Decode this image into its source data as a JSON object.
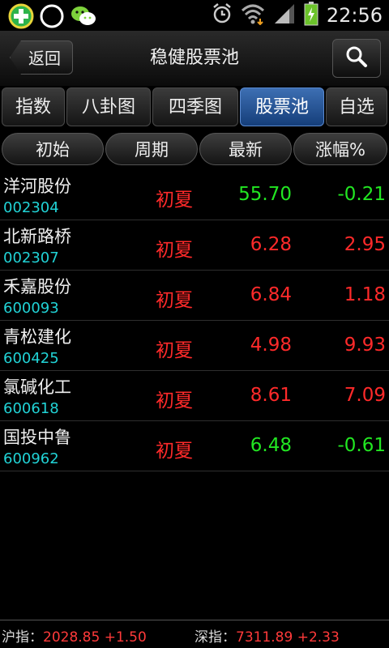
{
  "status_bar": {
    "time": "22:56",
    "left_icons": [
      "360-security-icon",
      "moon-app-icon",
      "wechat-icon"
    ],
    "right_icons": [
      "alarm-icon",
      "wifi-icon",
      "signal-icon",
      "battery-charging-icon"
    ]
  },
  "header": {
    "back_label": "返回",
    "title": "稳健股票池",
    "search_icon": "search-icon"
  },
  "tabs": [
    {
      "label": "指数"
    },
    {
      "label": "八卦图"
    },
    {
      "label": "四季图"
    },
    {
      "label": "股票池",
      "active": true
    },
    {
      "label": "自选"
    }
  ],
  "sort_header": [
    "初始",
    "周期",
    "最新",
    "涨幅%"
  ],
  "colors": {
    "up": "#ff2a2a",
    "down": "#22e622",
    "code": "#21d3d6",
    "tab_active": "#2a5ea8"
  },
  "stocks": [
    {
      "name": "洋河股份",
      "code": "002304",
      "period": "初夏",
      "price": "55.70",
      "change": "-0.21",
      "trend": "down"
    },
    {
      "name": "北新路桥",
      "code": "002307",
      "period": "初夏",
      "price": "6.28",
      "change": "2.95",
      "trend": "up"
    },
    {
      "name": "禾嘉股份",
      "code": "600093",
      "period": "初夏",
      "price": "6.84",
      "change": "1.18",
      "trend": "up"
    },
    {
      "name": "青松建化",
      "code": "600425",
      "period": "初夏",
      "price": "4.98",
      "change": "9.93",
      "trend": "up"
    },
    {
      "name": "氯碱化工",
      "code": "600618",
      "period": "初夏",
      "price": "8.61",
      "change": "7.09",
      "trend": "up"
    },
    {
      "name": "国投中鲁",
      "code": "600962",
      "period": "初夏",
      "price": "6.48",
      "change": "-0.61",
      "trend": "down"
    }
  ],
  "footer": {
    "sh_label": "沪指：",
    "sh_value": "2028.85 +1.50",
    "sz_label": "深指：",
    "sz_value": "7311.89 +2.33"
  }
}
